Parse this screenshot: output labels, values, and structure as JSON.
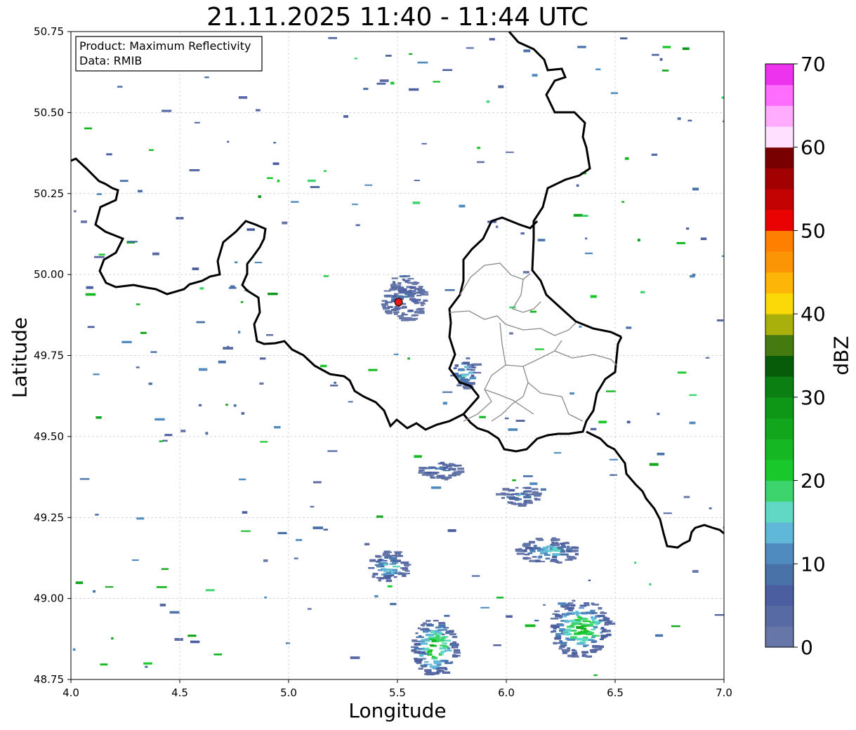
{
  "title": "21.11.2025 11:40 - 11:44 UTC",
  "xlabel": "Longitude",
  "ylabel": "Latitude",
  "info_box": {
    "product": "Product: Maximum Reflectivity",
    "data": "Data: RMIB"
  },
  "map": {
    "lon_range": [
      4.0,
      7.0
    ],
    "lat_range": [
      48.75,
      50.75
    ],
    "x_ticks": [
      "4.0",
      "4.5",
      "5.0",
      "5.5",
      "6.0",
      "6.5",
      "7.0"
    ],
    "y_ticks": [
      "50.75",
      "50.50",
      "50.25",
      "50.00",
      "49.75",
      "49.50",
      "49.25",
      "49.00",
      "48.75"
    ],
    "grid": true,
    "radar_site": {
      "lon": 5.505,
      "lat": 49.915,
      "color": "#e51a1a"
    }
  },
  "colorbar": {
    "label": "dBZ",
    "ticks": [
      "0",
      "10",
      "20",
      "30",
      "40",
      "50",
      "60",
      "70"
    ],
    "range": [
      0,
      70
    ],
    "colors": [
      "#6676a8",
      "#576aa3",
      "#4a5ea0",
      "#4872a8",
      "#4f8bbf",
      "#5fb8d8",
      "#60d8c4",
      "#3dd46e",
      "#19c82b",
      "#15b823",
      "#11a61b",
      "#0e9616",
      "#0b7f12",
      "#075c0a",
      "#447a0f",
      "#aab00b",
      "#fbd808",
      "#fdb508",
      "#fc9505",
      "#ff7f00",
      "#e80202",
      "#c30202",
      "#a20101",
      "#780000",
      "#ffe0ff",
      "#ffacff",
      "#ff6dff",
      "#ee33ee"
    ]
  },
  "echoes": [
    {
      "lon": 5.66,
      "lat": 48.85,
      "rlon": 0.1,
      "rlat": 0.09,
      "max_dbz": 32
    },
    {
      "lon": 6.33,
      "lat": 48.91,
      "rlon": 0.14,
      "rlat": 0.09,
      "max_dbz": 30
    },
    {
      "lon": 5.45,
      "lat": 49.1,
      "rlon": 0.09,
      "rlat": 0.05,
      "max_dbz": 22
    },
    {
      "lon": 6.18,
      "lat": 49.15,
      "rlon": 0.14,
      "rlat": 0.04,
      "max_dbz": 22
    },
    {
      "lon": 5.52,
      "lat": 49.93,
      "rlon": 0.1,
      "rlat": 0.07,
      "max_dbz": 12
    },
    {
      "lon": 5.8,
      "lat": 49.7,
      "rlon": 0.06,
      "rlat": 0.05,
      "max_dbz": 22
    },
    {
      "lon": 6.05,
      "lat": 49.32,
      "rlon": 0.1,
      "rlat": 0.03,
      "max_dbz": 16
    },
    {
      "lon": 5.68,
      "lat": 49.4,
      "rlon": 0.1,
      "rlat": 0.03,
      "max_dbz": 14
    }
  ],
  "colors": {
    "border": "#000000",
    "admin": "#8a8a8a",
    "grid": "#c8c8c8"
  }
}
